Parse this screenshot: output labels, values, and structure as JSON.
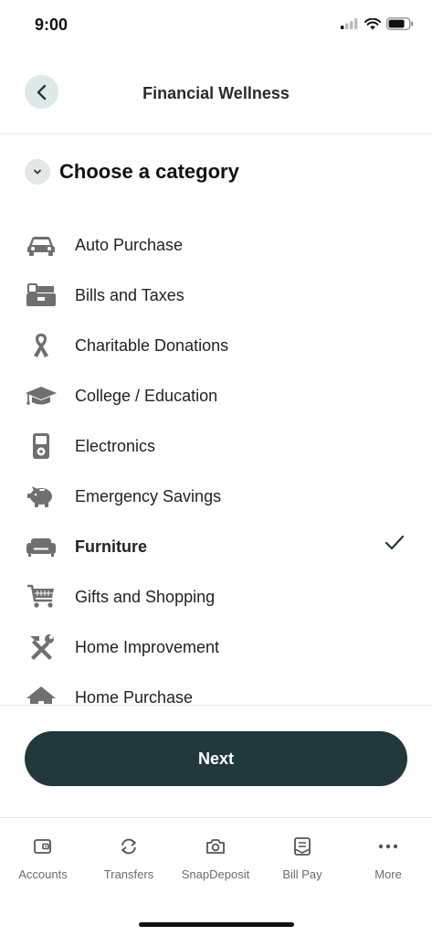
{
  "status_bar": {
    "time": "9:00"
  },
  "header": {
    "title": "Financial Wellness"
  },
  "section": {
    "title": "Choose a category"
  },
  "categories": [
    {
      "label": "Auto Purchase",
      "icon": "car-icon",
      "selected": false
    },
    {
      "label": "Bills and Taxes",
      "icon": "register-icon",
      "selected": false
    },
    {
      "label": "Charitable Donations",
      "icon": "ribbon-icon",
      "selected": false
    },
    {
      "label": "College / Education",
      "icon": "graduation-cap-icon",
      "selected": false
    },
    {
      "label": "Electronics",
      "icon": "ipod-icon",
      "selected": false
    },
    {
      "label": "Emergency Savings",
      "icon": "piggy-bank-icon",
      "selected": false
    },
    {
      "label": "Furniture",
      "icon": "sofa-icon",
      "selected": true
    },
    {
      "label": "Gifts and Shopping",
      "icon": "shopping-cart-icon",
      "selected": false
    },
    {
      "label": "Home Improvement",
      "icon": "tools-icon",
      "selected": false
    },
    {
      "label": "Home Purchase",
      "icon": "house-icon",
      "selected": false
    }
  ],
  "actions": {
    "next_label": "Next"
  },
  "tab_bar": {
    "tabs": [
      {
        "label": "Accounts",
        "icon": "wallet-icon"
      },
      {
        "label": "Transfers",
        "icon": "transfer-icon"
      },
      {
        "label": "SnapDeposit",
        "icon": "camera-icon"
      },
      {
        "label": "Bill Pay",
        "icon": "bill-icon"
      },
      {
        "label": "More",
        "icon": "more-icon"
      }
    ]
  },
  "colors": {
    "primary": "#21383d",
    "back_button_bg": "#dde9e7",
    "icon_gray": "#6f6f6f"
  }
}
